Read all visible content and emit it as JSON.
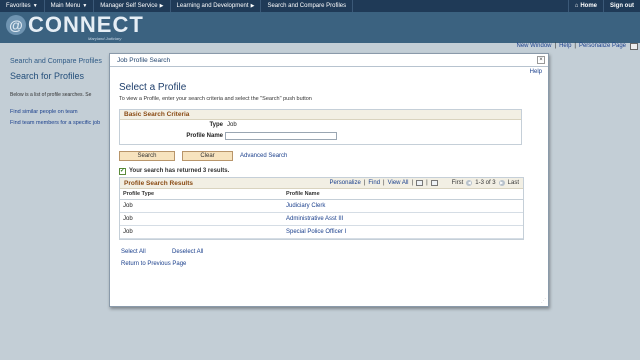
{
  "topnav": {
    "favorites": "Favorites",
    "main_menu": "Main Menu",
    "breadcrumb": [
      "Manager Self Service",
      "Learning and Development",
      "Search and Compare Profiles"
    ],
    "home": "Home",
    "sign_out": "Sign out"
  },
  "banner": {
    "logo_text": "CONNECT",
    "logo_sub": "Maryland Judiciary"
  },
  "util": {
    "new_window": "New Window",
    "help": "Help",
    "personalize": "Personalize Page"
  },
  "background": {
    "breadcrumb": "Search and Compare Profiles",
    "title": "Search for Profiles",
    "desc": "Below is a list of profile searches.  Se",
    "link1": "Find similar people on team",
    "link2": "Find team members for a specific job"
  },
  "modal": {
    "title": "Job Profile Search",
    "close": "×",
    "help": "Help",
    "select_title": "Select a Profile",
    "instructions": "To view a Profile, enter your search criteria and select the \"Search\" push button",
    "criteria": {
      "header": "Basic Search Criteria",
      "type_label": "Type",
      "type_value": "Job",
      "name_label": "Profile Name",
      "name_value": ""
    },
    "buttons": {
      "search": "Search",
      "clear": "Clear",
      "advanced": "Advanced Search"
    },
    "result_message": "Your search has returned 3 results.",
    "grid": {
      "title": "Profile Search Results",
      "personalize": "Personalize",
      "find": "Find",
      "view_all": "View All",
      "first": "First",
      "range": "1-3 of 3",
      "last": "Last",
      "col_type": "Profile Type",
      "col_name": "Profile Name",
      "rows": [
        {
          "type": "Job",
          "name": "Judiciary Clerk"
        },
        {
          "type": "Job",
          "name": "Administrative Asst III"
        },
        {
          "type": "Job",
          "name": "Special Police Officer I"
        }
      ]
    },
    "select_all": "Select All",
    "deselect_all": "Deselect All",
    "return": "Return to Previous Page"
  }
}
